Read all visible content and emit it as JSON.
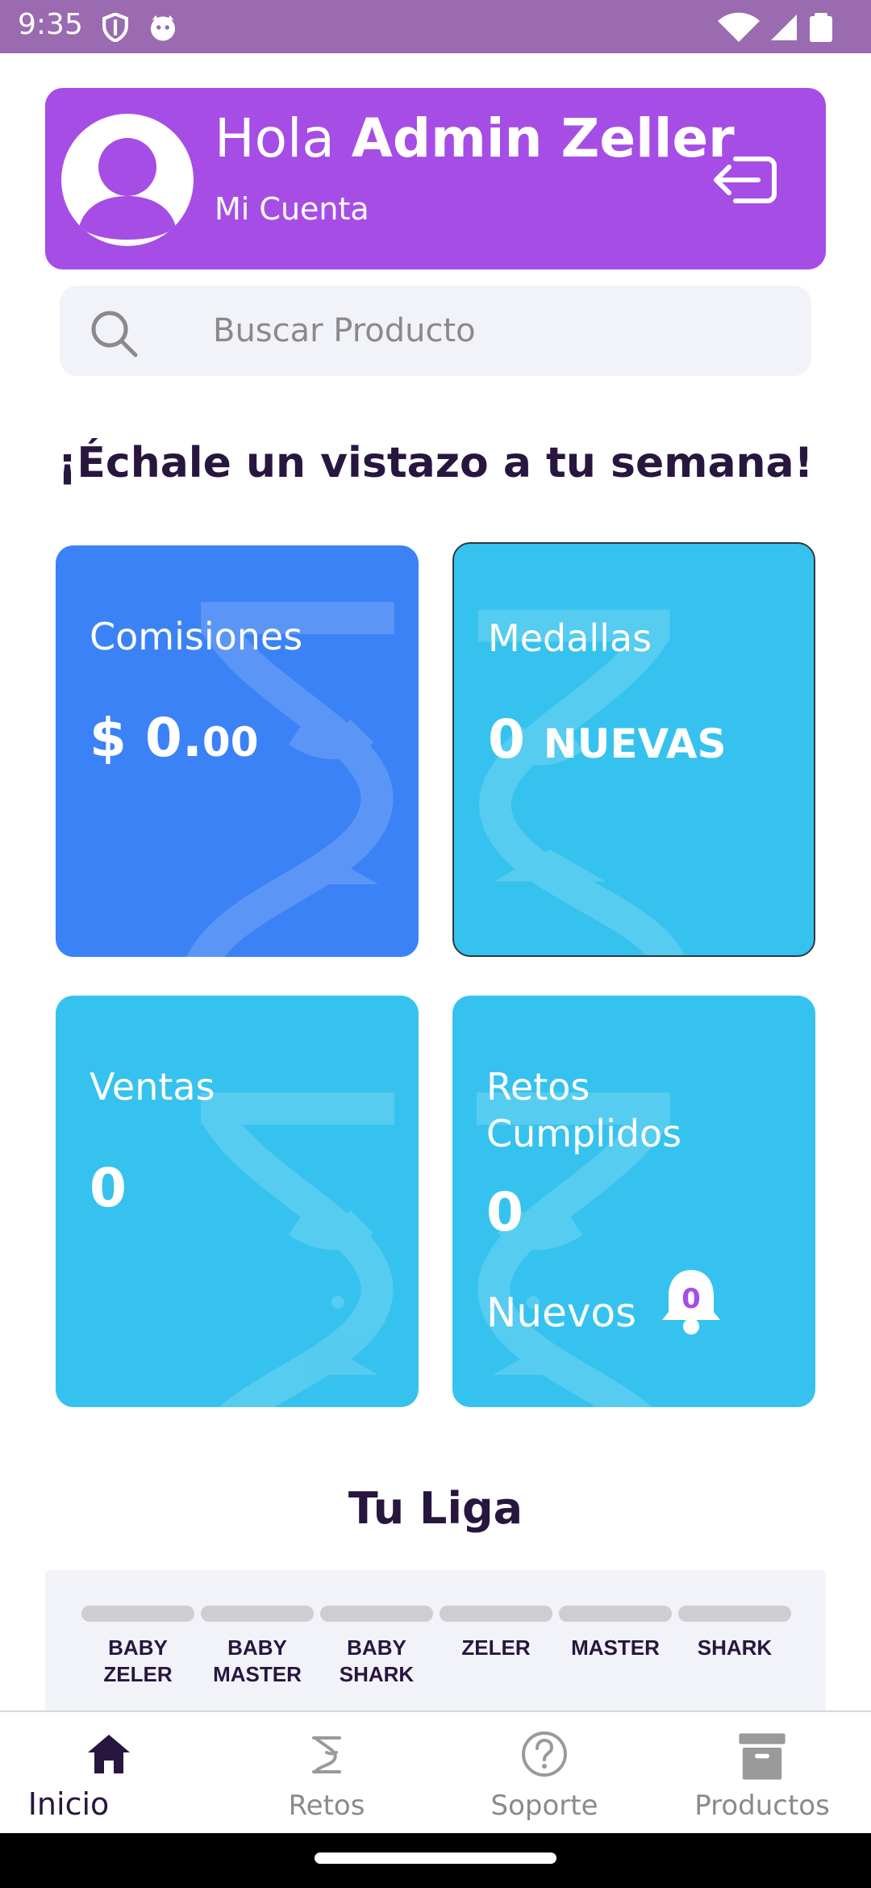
{
  "status_bar": {
    "time": "9:35"
  },
  "header": {
    "greeting": "Hola",
    "user_name": "Admin Zeller",
    "account_label": "Mi Cuenta"
  },
  "search": {
    "placeholder": "Buscar Producto"
  },
  "week_title": "¡Échale un vistazo a tu semana!",
  "cards": {
    "comisiones": {
      "label": "Comisiones",
      "value_main": "$ 0.",
      "value_cents": "00",
      "color": "#3b82f6"
    },
    "medallas": {
      "label": "Medallas",
      "value_main": "0",
      "value_suffix": "NUEVAS",
      "color": "#36c2ee"
    },
    "ventas": {
      "label": "Ventas",
      "value_main": "0",
      "color": "#36c2ee"
    },
    "retos": {
      "label": "Retos Cumplidos",
      "value_main": "0",
      "nuevos_label": "Nuevos",
      "bell_count": "0",
      "color": "#36c2ee"
    }
  },
  "liga": {
    "title": "Tu Liga",
    "levels": [
      {
        "line1": "BABY",
        "line2": "ZELER"
      },
      {
        "line1": "BABY",
        "line2": "MASTER"
      },
      {
        "line1": "BABY",
        "line2": "SHARK"
      },
      {
        "line1": "ZELER",
        "line2": ""
      },
      {
        "line1": "MASTER",
        "line2": ""
      },
      {
        "line1": "SHARK",
        "line2": ""
      }
    ]
  },
  "nav": {
    "items": [
      {
        "label": "Inicio",
        "icon": "home-icon",
        "active": true
      },
      {
        "label": "Retos",
        "icon": "z-logo-icon",
        "active": false
      },
      {
        "label": "Soporte",
        "icon": "help-icon",
        "active": false
      },
      {
        "label": "Productos",
        "icon": "archive-icon",
        "active": false
      }
    ]
  },
  "colors": {
    "header": "#a64de6",
    "status_bar": "#9a6bb0",
    "title_text": "#28163f",
    "bell_count": "#a64de6"
  }
}
